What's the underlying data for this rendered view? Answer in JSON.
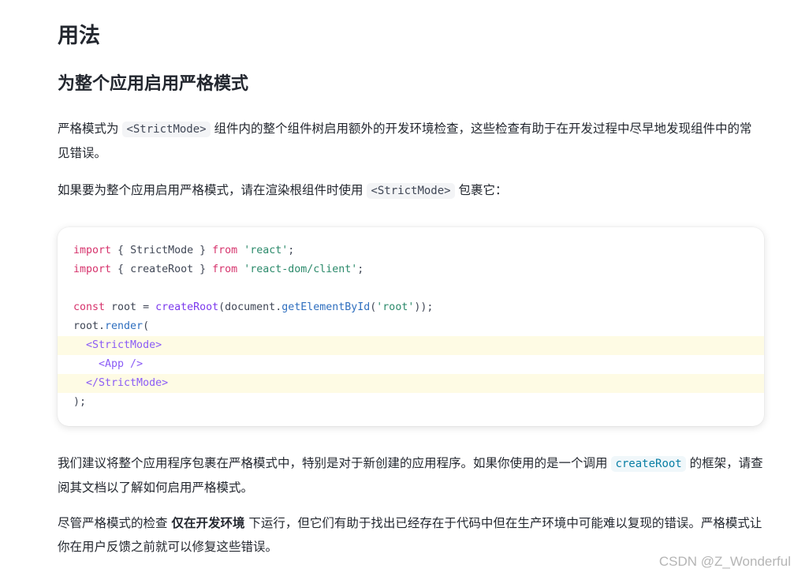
{
  "heading_1": "用法",
  "heading_2": "为整个应用启用严格模式",
  "para_1": {
    "before": "严格模式为 ",
    "code": "<StrictMode>",
    "after": " 组件内的整个组件树启用额外的开发环境检查，这些检查有助于在开发过程中尽早地发现组件中的常见错误。"
  },
  "para_2": {
    "before": "如果要为整个应用启用严格模式，请在渲染根组件时使用 ",
    "code": "<StrictMode>",
    "after": " 包裹它："
  },
  "code_block": {
    "l1": {
      "kw": "import",
      "a": " { StrictMode } ",
      "kw2": "from",
      "sp": " ",
      "str": "'react'",
      "end": ";"
    },
    "l2": {
      "kw": "import",
      "a": " { createRoot } ",
      "kw2": "from",
      "sp": " ",
      "str": "'react-dom/client'",
      "end": ";"
    },
    "l4": {
      "kw": "const",
      "a": " root = ",
      "fn": "createRoot",
      "b": "(document.",
      "fn2": "getElementById",
      "c": "(",
      "str": "'root'",
      "end": "));"
    },
    "l5": {
      "a": "root.",
      "fn": "render",
      "end": "("
    },
    "l6": {
      "indent": "  ",
      "tag": "<StrictMode>"
    },
    "l7": {
      "indent": "    ",
      "tag": "<App />"
    },
    "l8": {
      "indent": "  ",
      "tag": "</StrictMode>"
    },
    "l9": {
      "end": ");"
    }
  },
  "para_3": {
    "before": "我们建议将整个应用程序包裹在严格模式中，特别是对于新创建的应用程序。如果你使用的是一个调用 ",
    "code": "createRoot",
    "after": " 的框架，请查阅其文档以了解如何启用严格模式。"
  },
  "para_4": {
    "before": "尽管严格模式的检查 ",
    "strong": "仅在开发环境",
    "after": " 下运行，但它们有助于找出已经存在于代码中但在生产环境中可能难以复现的错误。严格模式让你在用户反馈之前就可以修复这些错误。"
  },
  "watermark": "CSDN @Z_Wonderful"
}
